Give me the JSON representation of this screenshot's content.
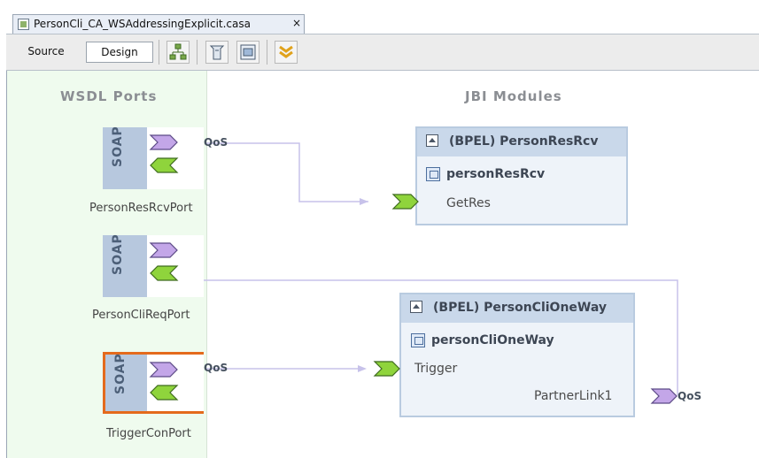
{
  "editor_tab": {
    "title": "PersonCli_CA_WSAddressingExplicit.casa",
    "close": "×"
  },
  "toolbar": {
    "source_label": "Source",
    "design_label": "Design",
    "icons": [
      "build-project-icon",
      "test-icon",
      "wsdl-icon",
      "collapse-icon"
    ]
  },
  "canvas": {
    "wsdl_header": "WSDL Ports",
    "jbi_header": "JBI Modules",
    "soap_label": "SOAP",
    "qos_label": "QoS",
    "ports": [
      {
        "name": "PersonResRcvPort"
      },
      {
        "name": "PersonCliReqPort"
      },
      {
        "name": "TriggerConPort"
      }
    ],
    "modules": [
      {
        "title": "(BPEL) PersonResRcv",
        "service_unit": "personResRcv",
        "endpoint": "GetRes"
      },
      {
        "title": "(BPEL) PersonCliOneWay",
        "service_unit": "personCliOneWay",
        "endpoint": "Trigger",
        "partner_link": "PartnerLink1"
      }
    ]
  },
  "colors": {
    "consume": "#c3a6e8",
    "provide": "#8fd43c",
    "link": "#c7c2ea",
    "soap": "#b7c8de",
    "selection": "#e46a1c"
  }
}
